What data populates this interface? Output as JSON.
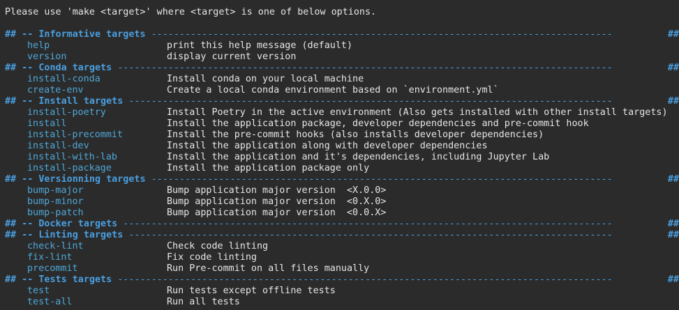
{
  "intro": "Please use 'make <target>' where <target> is one of below options.",
  "sections": [
    {
      "title": "## -- Informative targets",
      "dashes": " ----------------------------------------------------------------------------------",
      "items": [
        {
          "target": "help",
          "desc": "print this help message (default)"
        },
        {
          "target": "version",
          "desc": "display current version"
        }
      ]
    },
    {
      "title": "## -- Conda targets",
      "dashes": " ----------------------------------------------------------------------------------------",
      "items": [
        {
          "target": "install-conda",
          "desc": "Install conda on your local machine"
        },
        {
          "target": "create-env",
          "desc": "Create a local conda environment based on `environment.yml`"
        }
      ]
    },
    {
      "title": "## -- Install targets",
      "dashes": " --------------------------------------------------------------------------------------",
      "items": [
        {
          "target": "install-poetry",
          "desc": "Install Poetry in the active environment (Also gets installed with other install targets)"
        },
        {
          "target": "install",
          "desc": "Install the application package, developer dependencies and pre-commit hook"
        },
        {
          "target": "install-precommit",
          "desc": "Install the pre-commit hooks (also installs developer dependencies)"
        },
        {
          "target": "install-dev",
          "desc": "Install the application along with developer dependencies"
        },
        {
          "target": "install-with-lab",
          "desc": "Install the application and it's dependencies, including Jupyter Lab"
        },
        {
          "target": "install-package",
          "desc": "Install the application package only"
        }
      ]
    },
    {
      "title": "## -- Versionning targets",
      "dashes": " ----------------------------------------------------------------------------------",
      "items": [
        {
          "target": "bump-major",
          "desc": "Bump application major version  <X.0.0>"
        },
        {
          "target": "bump-minor",
          "desc": "Bump application major version  <0.X.0>"
        },
        {
          "target": "bump-patch",
          "desc": "Bump application major version  <0.0.X>"
        }
      ]
    },
    {
      "title": "## -- Docker targets",
      "dashes": " ---------------------------------------------------------------------------------------",
      "items": []
    },
    {
      "title": "## -- Linting targets",
      "dashes": " --------------------------------------------------------------------------------------",
      "items": [
        {
          "target": "check-lint",
          "desc": "Check code linting"
        },
        {
          "target": "fix-lint",
          "desc": "Fix code linting"
        },
        {
          "target": "precommit",
          "desc": "Run Pre-commit on all files manually"
        }
      ]
    },
    {
      "title": "## -- Tests targets",
      "dashes": " ----------------------------------------------------------------------------------------",
      "items": [
        {
          "target": "test",
          "desc": "Run tests except offline tests"
        },
        {
          "target": "test-all",
          "desc": "Run all tests"
        }
      ]
    }
  ],
  "header_tail": " ##",
  "colors": {
    "background": "#2b2b2b",
    "header": "#4a9fe0",
    "target": "#4fa8d8",
    "text": "#e6e6e6"
  }
}
